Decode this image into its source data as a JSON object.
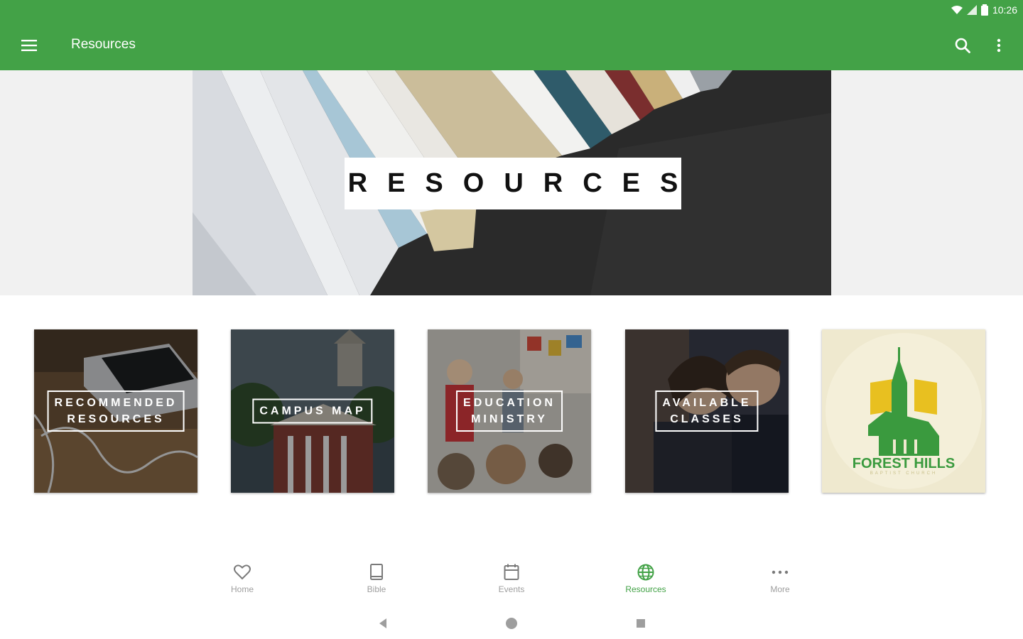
{
  "status_bar": {
    "time": "10:26"
  },
  "app_bar": {
    "title": "Resources",
    "color": "#43a247"
  },
  "hero": {
    "label": "RESOURCES"
  },
  "tiles": [
    {
      "label": "RECOMMENDED\nRESOURCES"
    },
    {
      "label": "CAMPUS MAP"
    },
    {
      "label": "EDUCATION\nMINISTRY"
    },
    {
      "label": "AVAILABLE\nCLASSES"
    },
    {
      "logo_text": "FOREST HILLS",
      "logo_sub": "BAPTIST CHURCH"
    }
  ],
  "bottom_nav": {
    "items": [
      {
        "label": "Home",
        "icon": "heart-icon"
      },
      {
        "label": "Bible",
        "icon": "book-icon"
      },
      {
        "label": "Events",
        "icon": "calendar-icon"
      },
      {
        "label": "Resources",
        "icon": "globe-icon",
        "active": true
      },
      {
        "label": "More",
        "icon": "more-horizontal-icon"
      }
    ],
    "active_color": "#43a247",
    "inactive_color": "#9e9e9e"
  }
}
